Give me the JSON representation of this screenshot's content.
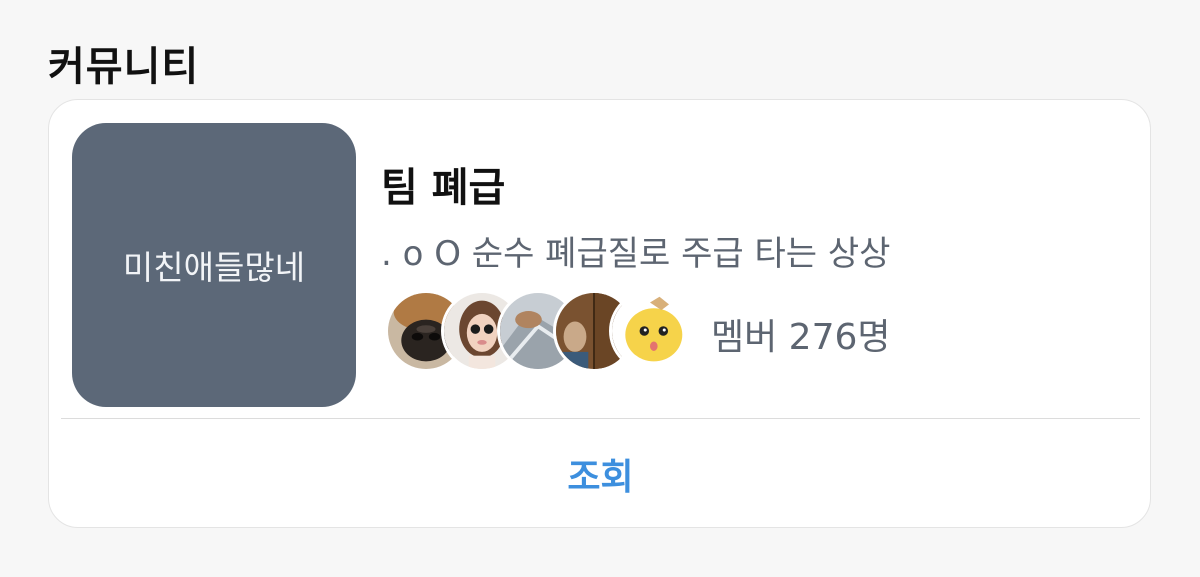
{
  "section": {
    "title": "커뮤니티"
  },
  "community": {
    "thumbnail_text": "미친애들많네",
    "thumbnail_color": "#5c6878",
    "name": "팀 폐급",
    "description": ". o O 순수 폐급질로 주급 타는 상상",
    "members_label": "멤버 276명",
    "member_avatars": [
      "dog-nose",
      "selfie-girl",
      "grey-dog",
      "door-person",
      "yellow-character"
    ]
  },
  "actions": {
    "view_label": "조회",
    "accent": "#3d8fde"
  }
}
